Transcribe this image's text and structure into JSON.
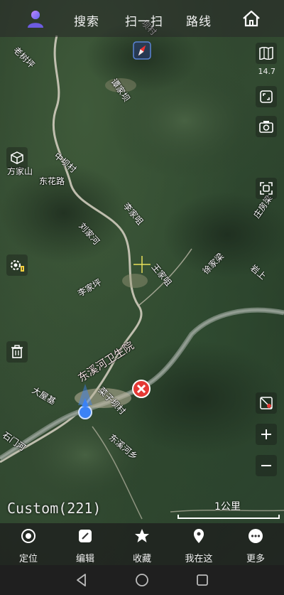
{
  "topbar": {
    "tabs": [
      "搜索",
      "扫一扫",
      "路线"
    ]
  },
  "map": {
    "zoom_level": "14.7",
    "labels": [
      "老树坪",
      "谭家坝",
      "中坝村",
      "东花路",
      "方家山",
      "刘家河",
      "李家咀",
      "李家坪",
      "王家咀",
      "徐家梁",
      "庄房梁",
      "岩上",
      "东溪河卫生院",
      "大屋基",
      "石门河",
      "菜子坝村",
      "东溪河乡",
      "坝村"
    ],
    "custom_layer": "Custom(221)",
    "scale": "1公里"
  },
  "bottom_nav": {
    "items": [
      "定位",
      "编辑",
      "收藏",
      "我在这",
      "更多"
    ]
  },
  "icons": {
    "avatar": "user-avatar-icon",
    "home": "home-icon",
    "compass": "compass-icon",
    "map_layers": "book-map-icon",
    "fullscreen": "fullscreen-icon",
    "camera": "camera-icon",
    "screenshot": "screenshot-icon",
    "layer_3d": "cube-icon",
    "settings_gps": "gear-gps-icon",
    "delete": "trash-icon",
    "layer_off": "layer-off-icon",
    "zoom_in": "plus-icon",
    "zoom_out": "minus-icon",
    "location_arrow": "location-arrow-icon",
    "poi_marker": "close-marker-icon"
  },
  "colors": {
    "accent": "#3b82f6",
    "marker_red": "#e53935",
    "avatar_purple": "#8b5cf6"
  }
}
